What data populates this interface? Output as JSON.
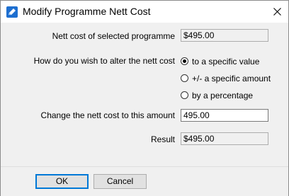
{
  "window": {
    "title": "Modify Programme Nett Cost",
    "title_icon": "pencil-icon",
    "close_icon": "close-icon"
  },
  "form": {
    "nett_cost_label": "Nett cost of selected programme",
    "nett_cost_value": "$495.00",
    "alter_label": "How do you wish to alter the nett cost",
    "options": [
      {
        "label": "to a specific value",
        "selected": true
      },
      {
        "label": "+/- a specific amount",
        "selected": false
      },
      {
        "label": "by a percentage",
        "selected": false
      }
    ],
    "change_label": "Change the nett cost to this amount",
    "change_value": "495.00",
    "result_label": "Result",
    "result_value": "$495.00"
  },
  "buttons": {
    "ok_label": "OK",
    "cancel_label": "Cancel"
  }
}
